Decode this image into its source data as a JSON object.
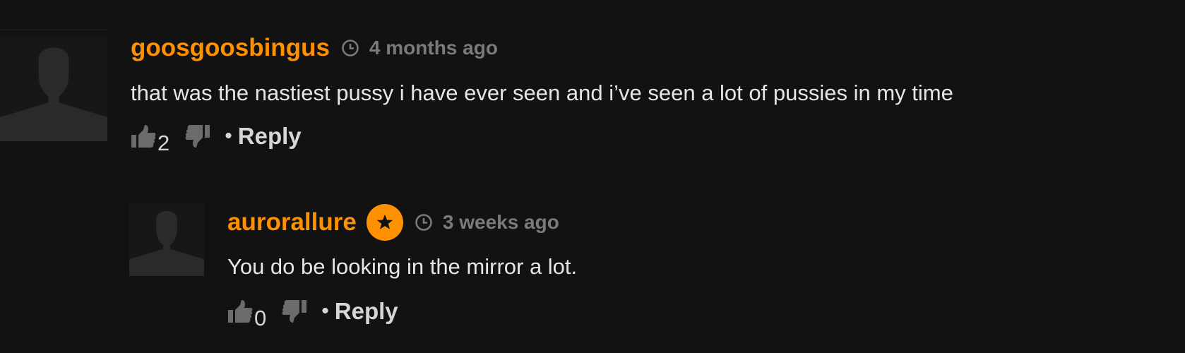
{
  "comments": [
    {
      "username": "goosgoosbingus",
      "time": "4 months ago",
      "text": "that was the nastiest pussy i have ever seen and i’ve seen a lot of pussies in my time",
      "upvotes": "2",
      "reply_label": "Reply",
      "separator": "•",
      "verified": false
    },
    {
      "username": "aurorallure",
      "time": "3 weeks ago",
      "text": "You do be looking in the mirror a lot.",
      "upvotes": "0",
      "reply_label": "Reply",
      "separator": "•",
      "verified": true
    }
  ],
  "colors": {
    "background": "#121212",
    "username": "#ff9000",
    "badge": "#ff9000",
    "timestamp": "#7a7a7a",
    "text": "#e6e6e6",
    "avatar_silhouette": "#2a2a2a"
  },
  "icons": {
    "clock": "clock-icon",
    "thumbs_up": "thumbs-up-icon",
    "thumbs_down": "thumbs-down-icon",
    "verified_badge": "star-badge-icon",
    "avatar": "default-avatar-icon"
  }
}
